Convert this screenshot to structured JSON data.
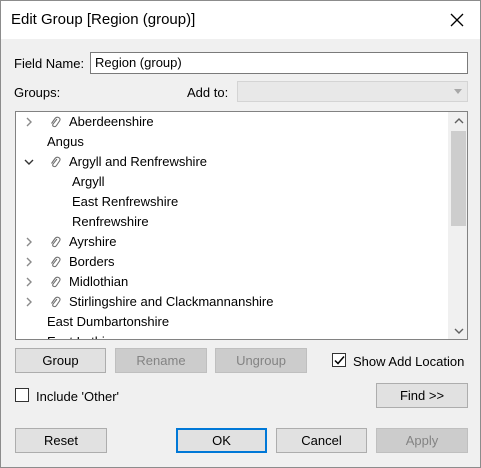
{
  "window": {
    "title": "Edit Group [Region (group)]"
  },
  "field_name": {
    "label": "Field Name:",
    "value": "Region (group)"
  },
  "groups": {
    "label": "Groups:",
    "add_to_label": "Add to:",
    "add_to_value": ""
  },
  "tree": {
    "items": [
      {
        "text": "Aberdeenshire",
        "chevron": "right",
        "clip": true,
        "level": 0
      },
      {
        "text": "Angus",
        "chevron": "",
        "clip": false,
        "level": 0
      },
      {
        "text": "Argyll and Renfrewshire",
        "chevron": "down",
        "clip": true,
        "level": 0
      },
      {
        "text": "Argyll",
        "chevron": "",
        "clip": false,
        "level": 1
      },
      {
        "text": "East Renfrewshire",
        "chevron": "",
        "clip": false,
        "level": 1
      },
      {
        "text": "Renfrewshire",
        "chevron": "",
        "clip": false,
        "level": 1
      },
      {
        "text": "Ayrshire",
        "chevron": "right",
        "clip": true,
        "level": 0
      },
      {
        "text": "Borders",
        "chevron": "right",
        "clip": true,
        "level": 0
      },
      {
        "text": "Midlothian",
        "chevron": "right",
        "clip": true,
        "level": 0
      },
      {
        "text": "Stirlingshire and Clackmannanshire",
        "chevron": "right",
        "clip": true,
        "level": 0
      },
      {
        "text": "East Dumbartonshire",
        "chevron": "",
        "clip": false,
        "level": 0
      },
      {
        "text": "East Lothian",
        "chevron": "",
        "clip": false,
        "level": 0
      }
    ]
  },
  "buttons": {
    "group": "Group",
    "rename": "Rename",
    "ungroup": "Ungroup",
    "find": "Find >>",
    "reset": "Reset",
    "ok": "OK",
    "cancel": "Cancel",
    "apply": "Apply"
  },
  "options": {
    "show_add_location": {
      "label": "Show Add Location",
      "checked": true
    },
    "include_other": {
      "label": "Include 'Other'",
      "checked": false
    }
  },
  "colors": {
    "accent": "#0078d7",
    "disabled_text": "#838383"
  }
}
